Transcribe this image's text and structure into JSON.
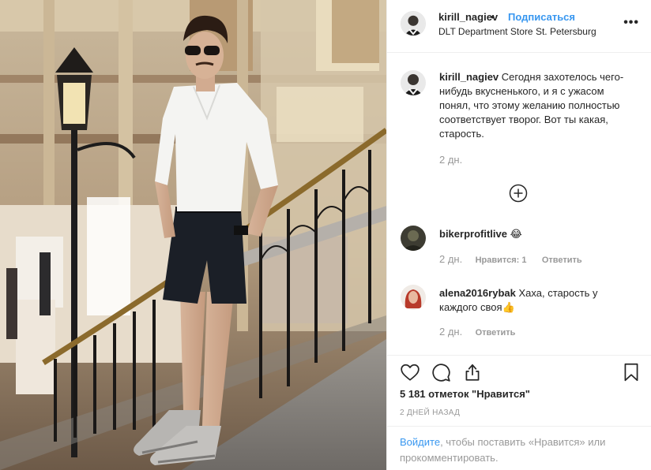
{
  "header": {
    "username": "kirill_nagiev",
    "separator": "•",
    "follow_label": "Подписаться",
    "location": "DLT Department Store St. Petersburg",
    "more_icon": "more-horizontal-icon"
  },
  "caption": {
    "username": "kirill_nagiev",
    "text": "Сегодня захотелось чего-нибудь вкусненького, и я с ужасом понял, что этому желанию полностью соответствует творог. Вот ты какая, старость.",
    "time": "2 дн."
  },
  "load_more_icon": "plus-circle-icon",
  "comments": [
    {
      "username": "bikerprofitlive",
      "text": "😂",
      "time": "2 дн.",
      "likes_label": "Нравится: 1",
      "reply_label": "Ответить"
    },
    {
      "username": "alena2016rybak",
      "text": "Хаха, старость у каждого своя👍",
      "time": "2 дн.",
      "reply_label": "Ответить"
    }
  ],
  "actions": {
    "like_icon": "heart-icon",
    "comment_icon": "comment-icon",
    "share_icon": "share-icon",
    "save_icon": "bookmark-icon",
    "likes_text": "5 181 отметок \"Нравится\"",
    "date": "2 ДНЕЙ НАЗАД"
  },
  "login_prompt": {
    "link": "Войдите",
    "text": ", чтобы поставить «Нравится» или прокомментировать."
  },
  "colors": {
    "accent": "#3897f0",
    "text": "#262626",
    "muted": "#999999",
    "divider": "#efefef"
  }
}
